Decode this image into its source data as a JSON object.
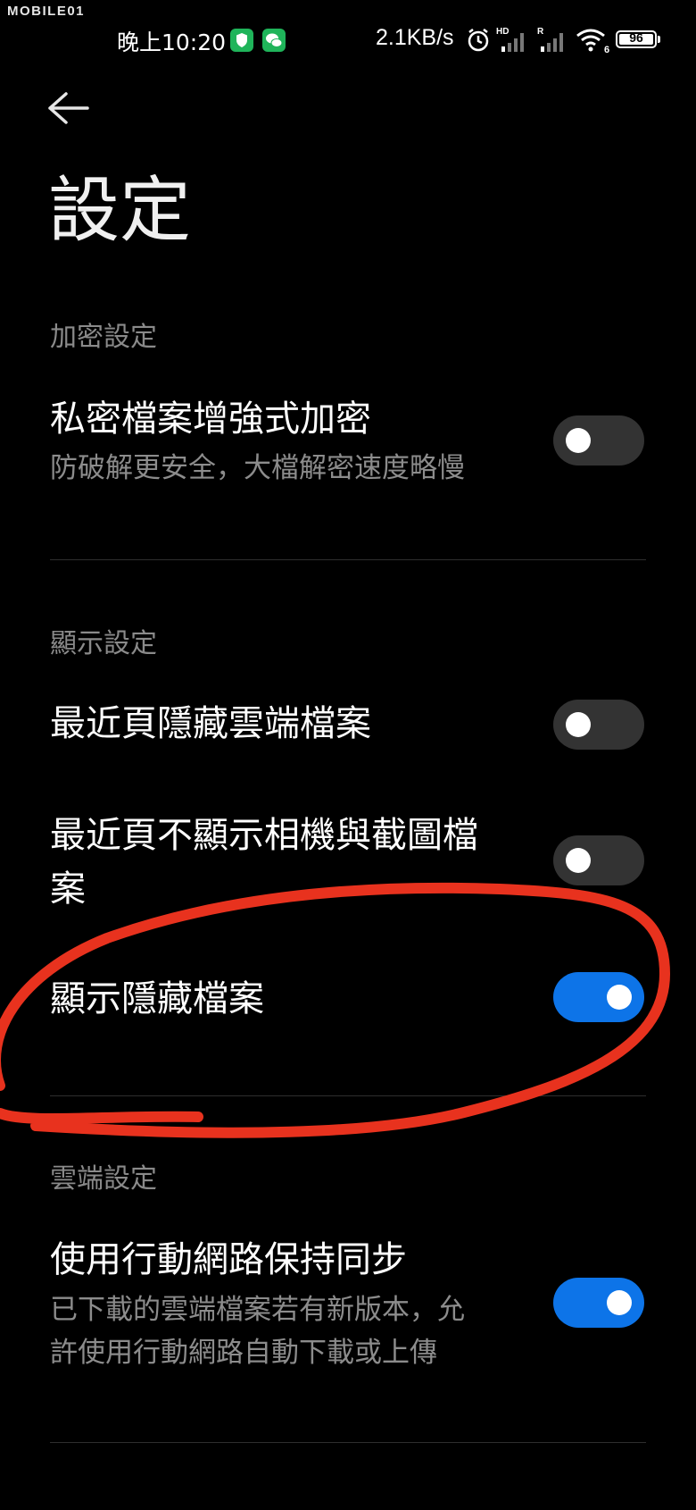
{
  "watermark": "MOBILE01",
  "status_bar": {
    "time": "晚上10:20",
    "net_speed": "2.1KB/s",
    "signal1_label": "HD",
    "signal2_label": "R",
    "wifi_label": "6",
    "battery": "96",
    "icons": [
      "shield-app-icon",
      "wechat-icon",
      "alarm-icon",
      "signal-icon",
      "wifi-icon",
      "battery-icon"
    ]
  },
  "header": {
    "back_icon": "arrow-left-icon",
    "title": "設定"
  },
  "sections": [
    {
      "title": "加密設定",
      "items": [
        {
          "title": "私密檔案增強式加密",
          "subtitle": "防破解更安全，大檔解密速度略慢",
          "enabled": false
        }
      ]
    },
    {
      "title": "顯示設定",
      "items": [
        {
          "title": "最近頁隱藏雲端檔案",
          "enabled": false
        },
        {
          "title_line1": "最近頁不顯示相機與截圖檔",
          "title_line2": "案",
          "enabled": false
        },
        {
          "title": "顯示隱藏檔案",
          "enabled": true
        }
      ]
    },
    {
      "title": "雲端設定",
      "items": [
        {
          "title": "使用行動網路保持同步",
          "subtitle_line1": "已下載的雲端檔案若有新版本，允",
          "subtitle_line2": "許使用行動網路自動下載或上傳",
          "enabled": true
        }
      ]
    }
  ],
  "colors": {
    "background": "#000000",
    "toggle_on": "#0d74e8",
    "toggle_off": "#333333",
    "annotation": "#e8321e",
    "muted_text": "#8a8a8a"
  }
}
